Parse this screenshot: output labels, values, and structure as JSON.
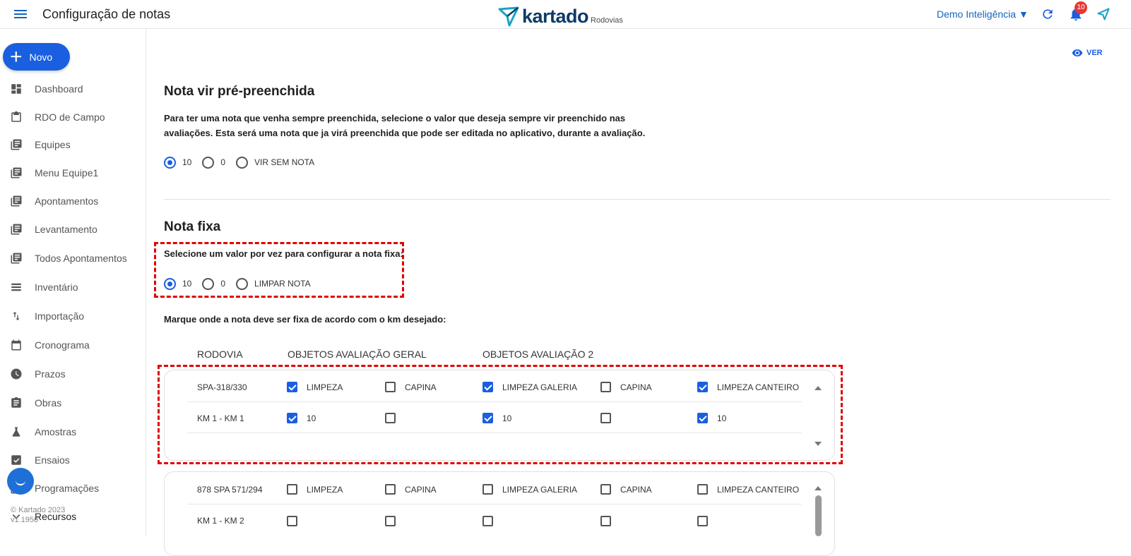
{
  "header": {
    "title": "Configuração de notas",
    "logo_text": "kartado",
    "logo_sub": "Rodovias",
    "account": "Demo Inteligência ▼",
    "notifications": "10"
  },
  "sidebar": {
    "new_label": "Novo",
    "items": [
      {
        "label": "Dashboard",
        "icon": "dashboard-icon"
      },
      {
        "label": "RDO de Campo",
        "icon": "clipboard-icon"
      },
      {
        "label": "Equipes",
        "icon": "library-books-icon"
      },
      {
        "label": "Menu Equipe1",
        "icon": "library-books-icon"
      },
      {
        "label": "Apontamentos",
        "icon": "library-books-icon"
      },
      {
        "label": "Levantamento",
        "icon": "library-books-icon"
      },
      {
        "label": "Todos Apontamentos",
        "icon": "library-books-icon"
      },
      {
        "label": "Inventário",
        "icon": "list-icon"
      },
      {
        "label": "Importação",
        "icon": "import-export-icon"
      },
      {
        "label": "Cronograma",
        "icon": "calendar-icon"
      },
      {
        "label": "Prazos",
        "icon": "clock-icon"
      },
      {
        "label": "Obras",
        "icon": "assignment-icon"
      },
      {
        "label": "Amostras",
        "icon": "flask-icon"
      },
      {
        "label": "Ensaios",
        "icon": "checklist-icon"
      },
      {
        "label": "Programações",
        "icon": "library-books-icon"
      },
      {
        "label": "Recursos",
        "icon": "chevron-down-icon"
      }
    ],
    "copyright": "© Kartado 2023",
    "version": "v1.1950"
  },
  "main": {
    "view_label": "VER",
    "prefilled": {
      "title": "Nota vir pré-preenchida",
      "description_line1": "Para ter uma nota que venha sempre preenchida, selecione o valor que deseja sempre vir preenchido nas",
      "description_line2": "avaliações. Esta será uma nota que ja virá preenchida que pode ser editada no aplicativo, durante a avaliação.",
      "options": [
        {
          "label": "10",
          "selected": true
        },
        {
          "label": "0",
          "selected": false
        },
        {
          "label": "VIR SEM NOTA",
          "selected": false
        }
      ]
    },
    "fixed": {
      "title": "Nota fixa",
      "instruction": "Selecione um valor por vez para configurar a nota fixa:",
      "options": [
        {
          "label": "10",
          "selected": true
        },
        {
          "label": "0",
          "selected": false
        },
        {
          "label": "LIMPAR NOTA",
          "selected": false
        }
      ],
      "km_instruction": "Marque onde a nota deve ser fixa de acordo com o km desejado:",
      "columns": [
        "RODOVIA",
        "OBJETOS AVALIAÇÃO GERAL",
        "OBJETOS AVALIAÇÃO 2"
      ]
    },
    "cards": [
      {
        "road": "SPA-318/330",
        "km": "KM 1 - KM 1",
        "items": [
          {
            "label": "LIMPEZA",
            "checked": true,
            "km_checked": true,
            "km_value": "10"
          },
          {
            "label": "CAPINA",
            "checked": false,
            "km_checked": false,
            "km_value": ""
          },
          {
            "label": "LIMPEZA GALERIA",
            "checked": true,
            "km_checked": true,
            "km_value": "10"
          },
          {
            "label": "CAPINA",
            "checked": false,
            "km_checked": false,
            "km_value": ""
          },
          {
            "label": "LIMPEZA CANTEIRO",
            "checked": true,
            "km_checked": true,
            "km_value": "10"
          }
        ]
      },
      {
        "road": "878 SPA 571/294",
        "km": "KM 1 - KM 2",
        "items": [
          {
            "label": "LIMPEZA",
            "checked": false,
            "km_checked": false,
            "km_value": ""
          },
          {
            "label": "CAPINA",
            "checked": false,
            "km_checked": false,
            "km_value": ""
          },
          {
            "label": "LIMPEZA GALERIA",
            "checked": false,
            "km_checked": false,
            "km_value": ""
          },
          {
            "label": "CAPINA",
            "checked": false,
            "km_checked": false,
            "km_value": ""
          },
          {
            "label": "LIMPEZA CANTEIRO",
            "checked": false,
            "km_checked": false,
            "km_value": ""
          }
        ]
      }
    ]
  },
  "colors": {
    "accent": "#1a5fe0",
    "highlight": "#e00000",
    "logo": "#0d3b66"
  }
}
